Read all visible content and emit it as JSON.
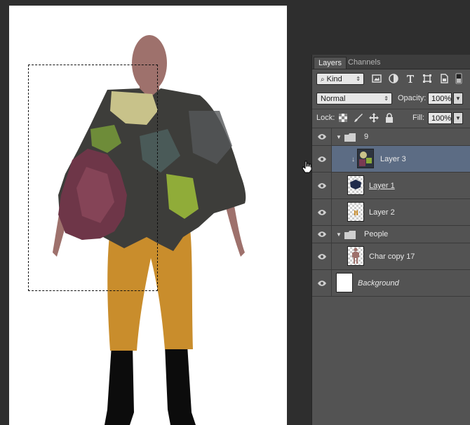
{
  "panel": {
    "tabs": [
      "Layers",
      "Channels"
    ],
    "filter": {
      "kind_label": "Kind"
    },
    "blend": {
      "mode": "Normal",
      "opacity_label": "Opacity:",
      "opacity_value": "100%"
    },
    "lock": {
      "label": "Lock:",
      "fill_label": "Fill:",
      "fill_value": "100%"
    }
  },
  "layers": [
    {
      "name": "9",
      "type": "group",
      "visible": true,
      "expanded": true
    },
    {
      "name": "Layer 3",
      "type": "layer",
      "visible": true,
      "selected": true,
      "clipped": true
    },
    {
      "name": "Layer 1",
      "type": "layer",
      "visible": true,
      "underline": true
    },
    {
      "name": "Layer 2",
      "type": "layer",
      "visible": true
    },
    {
      "name": "People",
      "type": "group",
      "visible": true,
      "expanded": true
    },
    {
      "name": "Char copy 17",
      "type": "layer",
      "visible": true
    },
    {
      "name": "Background",
      "type": "layer",
      "visible": true,
      "italic": true
    }
  ],
  "colors": {
    "canvas_bg": "#ffffff",
    "workspace_bg": "#2e2e2e",
    "panel_bg": "#535353",
    "selected_row": "#5c6c84",
    "skin": "#9e716c",
    "pants": "#c98d2c",
    "boots": "#0c0c0c",
    "poncho_dark": "#3d3d3a",
    "poncho_purple": "#6e3648",
    "poncho_green": "#9fc03a"
  }
}
